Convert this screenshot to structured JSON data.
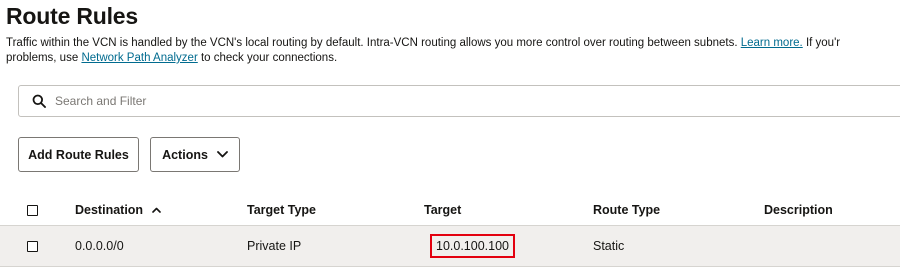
{
  "page": {
    "title": "Route Rules"
  },
  "description": {
    "part1": "Traffic within the VCN is handled by the VCN's local routing by default. Intra-VCN routing allows you more control over routing between subnets. ",
    "learn_more_link": "Learn more.",
    "part2": " If you'r",
    "part3": "problems, use ",
    "network_path_link": "Network Path Analyzer",
    "part4": " to check your connections."
  },
  "search": {
    "placeholder": "Search and Filter",
    "icon": "search-icon"
  },
  "toolbar": {
    "add_label": "Add Route Rules",
    "actions_label": "Actions",
    "actions_icon": "chevron-down-icon"
  },
  "table": {
    "headers": {
      "destination": "Destination",
      "target_type": "Target Type",
      "target": "Target",
      "route_type": "Route Type",
      "description": "Description"
    },
    "sort_icon": "sort-ascending-icon",
    "rows": [
      {
        "destination": "0.0.0.0/0",
        "target_type": "Private IP",
        "target": "10.0.100.100",
        "route_type": "Static",
        "description": ""
      }
    ]
  },
  "colors": {
    "link": "#006b8f",
    "highlight": "#e3000f",
    "row_background": "#f1efed"
  }
}
